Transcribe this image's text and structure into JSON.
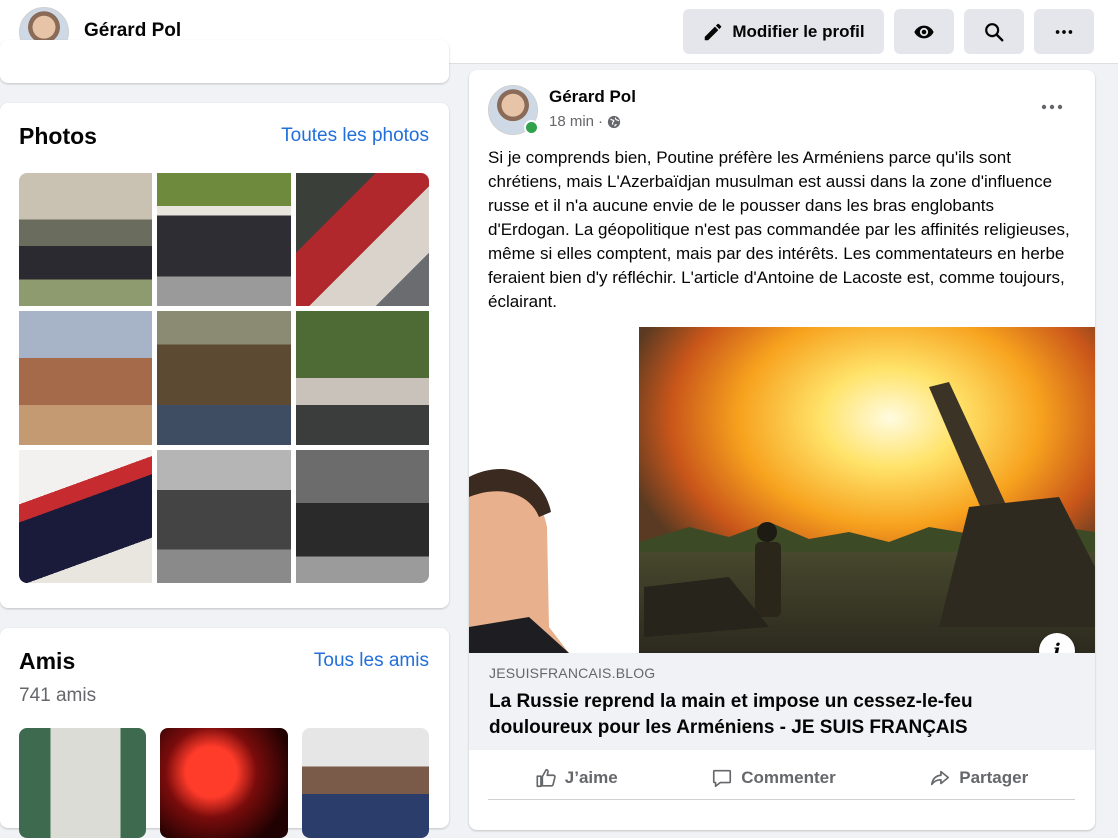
{
  "header": {
    "name": "Gérard Pol",
    "edit_profile_label": "Modifier le profil"
  },
  "photos": {
    "title": "Photos",
    "see_all": "Toutes les photos"
  },
  "friends": {
    "title": "Amis",
    "see_all": "Tous les amis",
    "count": "741 amis"
  },
  "post": {
    "author": "Gérard Pol",
    "time": "18 min",
    "separator": "·",
    "text": "Si je comprends bien, Poutine préfère les Arméniens parce qu'ils sont chrétiens, mais L'Azerbaïdjan musulman est aussi dans la zone d'influence russe et il n'a aucune envie de le pousser dans les bras englobants d'Erdogan. La géopolitique n'est pas commandée par les affinités religieuses, même si elles comptent, mais par des intérêts. Les commentateurs en herbe feraient bien d'y réfléchir. L'article d'Antoine de Lacoste est, comme toujours, éclairant.",
    "link_domain": "JESUISFRANCAIS.BLOG",
    "link_title": "La Russie reprend la main et impose un cessez-le-feu douloureux pour les Arméniens - JE SUIS FRANÇAIS",
    "info_glyph": "i",
    "actions": {
      "like": "J’aime",
      "comment": "Commenter",
      "share": "Partager"
    }
  },
  "colors": {
    "link": "#216fdb",
    "button_bg": "#e4e6eb",
    "online": "#31a24c",
    "muted": "#65676b"
  }
}
